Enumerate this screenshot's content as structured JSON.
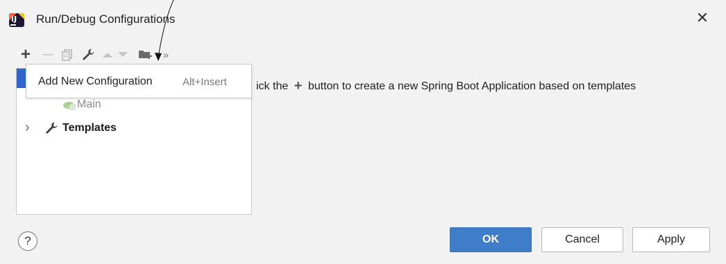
{
  "window": {
    "title": "Run/Debug Configurations",
    "close_glyph": "✕",
    "app_icon": "intellij-logo",
    "app_icon_glyph": "IJ"
  },
  "toolbar": {
    "add_glyph": "+",
    "remove_glyph": "—",
    "more_glyph": "»",
    "icons": [
      "plus-icon",
      "minus-icon",
      "copy-icon",
      "wrench-icon",
      "arrow-up-icon",
      "arrow-down-icon",
      "folder-add-icon",
      "more-icon"
    ]
  },
  "tooltip": {
    "label": "Add New Configuration",
    "shortcut": "Alt+Insert"
  },
  "tree": {
    "items": [
      {
        "label": "Main",
        "icon": "spring-boot-icon"
      },
      {
        "label": "Templates",
        "icon": "wrench-icon",
        "expander": "›"
      }
    ]
  },
  "hint": {
    "prefix": "ick the",
    "plus_glyph": "+",
    "suffix": "button to create a new Spring Boot Application based on templates"
  },
  "footer": {
    "help_glyph": "?",
    "ok_label": "OK",
    "cancel_label": "Cancel",
    "apply_label": "Apply"
  },
  "colors": {
    "accent": "#3f7dc8",
    "selection": "#2f65ca",
    "background": "#f2f2f2"
  }
}
